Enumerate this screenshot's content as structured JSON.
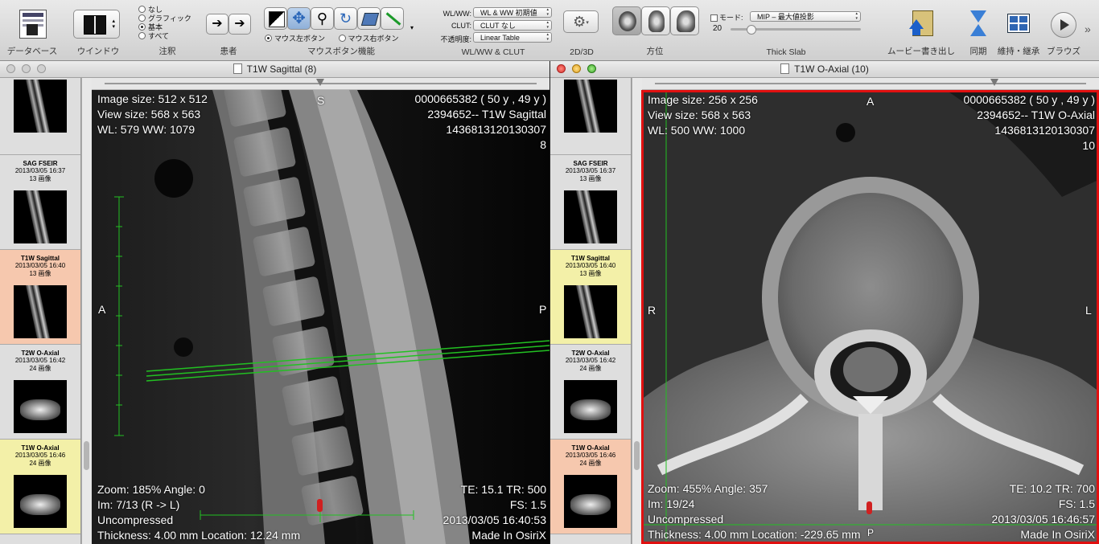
{
  "toolbar": {
    "database_label": "データベース",
    "window_label": "ウインドウ",
    "annotation": {
      "options": [
        "なし",
        "グラフィック",
        "基本",
        "すべて"
      ],
      "selected": 2,
      "label": "注釈"
    },
    "patient_label": "患者",
    "mouse": {
      "left_label": "マウス左ボタン",
      "right_label": "マウス右ボタン",
      "label": "マウスボタン機能"
    },
    "wlww": {
      "wl_label": "WL/WW:",
      "wl_value": "WL & WW 初期値",
      "clut_label": "CLUT:",
      "clut_value": "CLUT なし",
      "opacity_label": "不透明度:",
      "opacity_value": "Linear Table",
      "label": "WL/WW & CLUT"
    },
    "label_2d3d": "2D/3D",
    "orientation_label": "方位",
    "thickslab": {
      "mode_label": "モード:",
      "mode_value": "MIP – 最大値投影",
      "value": "20",
      "label": "Thick Slab"
    },
    "movie_label": "ムービー書き出し",
    "sync_label": "同期",
    "tile_label": "維持‧継承",
    "browse_label": "ブラウズ"
  },
  "series": [
    {
      "name": "",
      "date": "",
      "count": ""
    },
    {
      "name": "SAG FSEIR",
      "date": "2013/03/05 16:37",
      "count": "13 画像"
    },
    {
      "name": "T1W Sagittal",
      "date": "2013/03/05 16:40",
      "count": "13 画像"
    },
    {
      "name": "T2W O-Axial",
      "date": "2013/03/05 16:42",
      "count": "24 画像"
    },
    {
      "name": "T1W O-Axial",
      "date": "2013/03/05 16:46",
      "count": "24 画像"
    }
  ],
  "left_window": {
    "title": "T1W Sagittal (8)",
    "overlay": {
      "tl": "Image size: 512 x 512\nView size: 568 x 563\nWL: 579 WW: 1079",
      "tr": "0000665382 ( 50 y , 49 y )\n2394652-- T1W Sagittal\n1436813120130307\n8",
      "bl": "Zoom: 185% Angle: 0\nIm: 7/13 (R -> L)\nUncompressed\nThickness: 4.00 mm Location: 12.24 mm",
      "br": "TE: 15.1 TR: 500\nFS: 1.5\n2013/03/05 16:40:53\nMade In OsiriX",
      "top": "S",
      "left": "A",
      "right": "P"
    }
  },
  "right_window": {
    "title": "T1W O-Axial (10)",
    "overlay": {
      "tl": "Image size: 256 x 256\nView size: 568 x 563\nWL: 500 WW: 1000",
      "tr": "0000665382 ( 50 y , 49 y )\n2394652-- T1W O-Axial\n1436813120130307\n10",
      "bl": "Zoom: 455% Angle: 357\nIm: 19/24\nUncompressed\nThickness: 4.00 mm Location: -229.65 mm",
      "br": "TE: 10.2 TR: 700\nFS: 1.5\n2013/03/05 16:46:57\nMade In OsiriX",
      "top": "A",
      "left": "R",
      "right": "L",
      "bottom": "P"
    }
  },
  "colors": {
    "active_border": "#e01010",
    "ref_lines": "#22c022",
    "selected_series": "#f6c8ae",
    "highlight_series": "#f3f0a8"
  }
}
